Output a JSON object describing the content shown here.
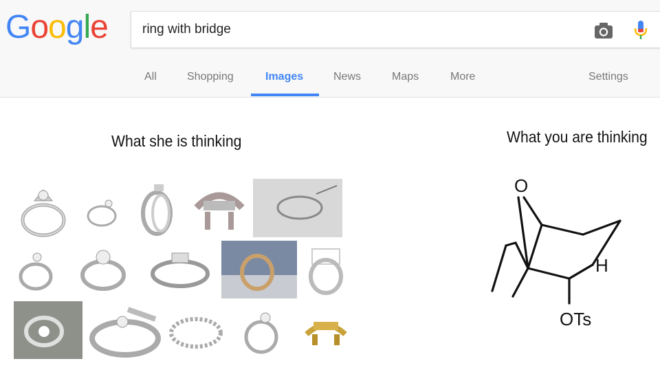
{
  "logo": {
    "letters": [
      "G",
      "o",
      "o",
      "g",
      "l",
      "e"
    ],
    "colors": [
      "#4285f4",
      "#ea4335",
      "#fbbc05",
      "#4285f4",
      "#34a853",
      "#ea4335"
    ]
  },
  "search": {
    "query": "ring with bridge",
    "camera_icon": "camera-icon",
    "mic_icon": "microphone-icon"
  },
  "tabs": [
    {
      "label": "All",
      "active": false
    },
    {
      "label": "Shopping",
      "active": false
    },
    {
      "label": "Images",
      "active": true
    },
    {
      "label": "News",
      "active": false
    },
    {
      "label": "Maps",
      "active": false
    },
    {
      "label": "More",
      "active": false
    },
    {
      "label": "Settings",
      "active": false
    }
  ],
  "accent_color": "#4285f4",
  "left_panel": {
    "caption": "What she is thinking"
  },
  "right_panel": {
    "caption": "What you are thinking",
    "atom_o": "O",
    "atom_h": "H",
    "group_ots": "OTs"
  }
}
